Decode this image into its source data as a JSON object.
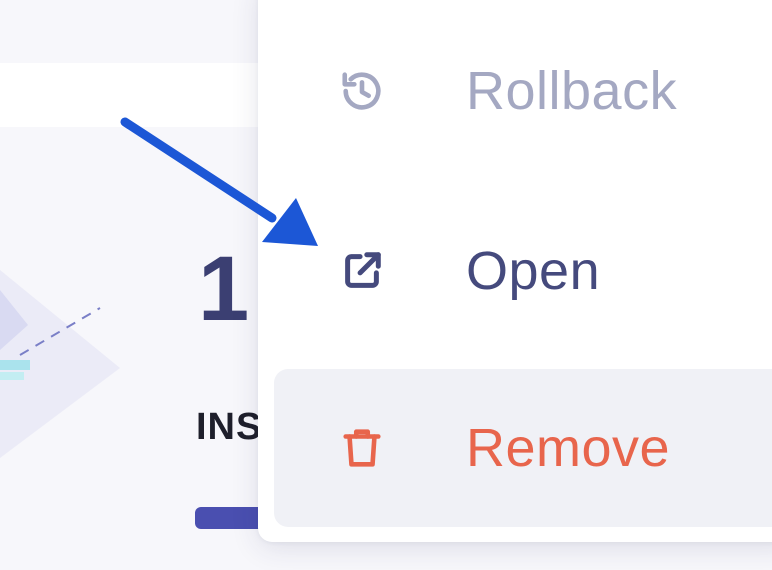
{
  "background": {
    "stat_number": "1",
    "stat_label": "INS"
  },
  "menu": {
    "items": [
      {
        "label": "Rollback",
        "icon": "history-icon",
        "color": "#a4a8c2"
      },
      {
        "label": "Open",
        "icon": "external-link-icon",
        "color": "#454a7d"
      },
      {
        "label": "Remove",
        "icon": "trash-icon",
        "color": "#e8654c"
      }
    ]
  },
  "colors": {
    "accent": "#4a4fb0",
    "danger": "#e8654c",
    "annotation_arrow": "#1c57d6",
    "highlight_bg": "#f0f1f6"
  }
}
